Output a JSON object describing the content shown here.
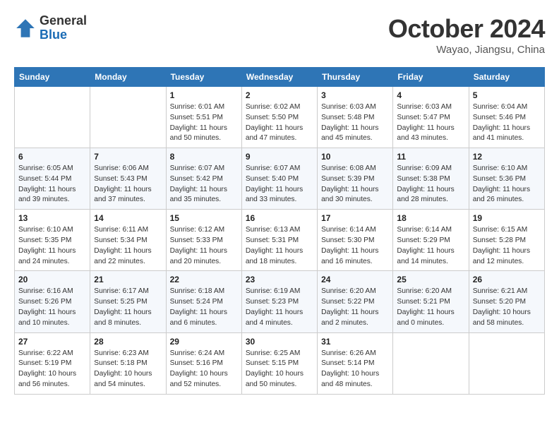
{
  "header": {
    "logo_general": "General",
    "logo_blue": "Blue",
    "month_title": "October 2024",
    "location": "Wayao, Jiangsu, China"
  },
  "days_of_week": [
    "Sunday",
    "Monday",
    "Tuesday",
    "Wednesday",
    "Thursday",
    "Friday",
    "Saturday"
  ],
  "weeks": [
    [
      {
        "day": "",
        "sunrise": "",
        "sunset": "",
        "daylight": ""
      },
      {
        "day": "",
        "sunrise": "",
        "sunset": "",
        "daylight": ""
      },
      {
        "day": "1",
        "sunrise": "Sunrise: 6:01 AM",
        "sunset": "Sunset: 5:51 PM",
        "daylight": "Daylight: 11 hours and 50 minutes."
      },
      {
        "day": "2",
        "sunrise": "Sunrise: 6:02 AM",
        "sunset": "Sunset: 5:50 PM",
        "daylight": "Daylight: 11 hours and 47 minutes."
      },
      {
        "day": "3",
        "sunrise": "Sunrise: 6:03 AM",
        "sunset": "Sunset: 5:48 PM",
        "daylight": "Daylight: 11 hours and 45 minutes."
      },
      {
        "day": "4",
        "sunrise": "Sunrise: 6:03 AM",
        "sunset": "Sunset: 5:47 PM",
        "daylight": "Daylight: 11 hours and 43 minutes."
      },
      {
        "day": "5",
        "sunrise": "Sunrise: 6:04 AM",
        "sunset": "Sunset: 5:46 PM",
        "daylight": "Daylight: 11 hours and 41 minutes."
      }
    ],
    [
      {
        "day": "6",
        "sunrise": "Sunrise: 6:05 AM",
        "sunset": "Sunset: 5:44 PM",
        "daylight": "Daylight: 11 hours and 39 minutes."
      },
      {
        "day": "7",
        "sunrise": "Sunrise: 6:06 AM",
        "sunset": "Sunset: 5:43 PM",
        "daylight": "Daylight: 11 hours and 37 minutes."
      },
      {
        "day": "8",
        "sunrise": "Sunrise: 6:07 AM",
        "sunset": "Sunset: 5:42 PM",
        "daylight": "Daylight: 11 hours and 35 minutes."
      },
      {
        "day": "9",
        "sunrise": "Sunrise: 6:07 AM",
        "sunset": "Sunset: 5:40 PM",
        "daylight": "Daylight: 11 hours and 33 minutes."
      },
      {
        "day": "10",
        "sunrise": "Sunrise: 6:08 AM",
        "sunset": "Sunset: 5:39 PM",
        "daylight": "Daylight: 11 hours and 30 minutes."
      },
      {
        "day": "11",
        "sunrise": "Sunrise: 6:09 AM",
        "sunset": "Sunset: 5:38 PM",
        "daylight": "Daylight: 11 hours and 28 minutes."
      },
      {
        "day": "12",
        "sunrise": "Sunrise: 6:10 AM",
        "sunset": "Sunset: 5:36 PM",
        "daylight": "Daylight: 11 hours and 26 minutes."
      }
    ],
    [
      {
        "day": "13",
        "sunrise": "Sunrise: 6:10 AM",
        "sunset": "Sunset: 5:35 PM",
        "daylight": "Daylight: 11 hours and 24 minutes."
      },
      {
        "day": "14",
        "sunrise": "Sunrise: 6:11 AM",
        "sunset": "Sunset: 5:34 PM",
        "daylight": "Daylight: 11 hours and 22 minutes."
      },
      {
        "day": "15",
        "sunrise": "Sunrise: 6:12 AM",
        "sunset": "Sunset: 5:33 PM",
        "daylight": "Daylight: 11 hours and 20 minutes."
      },
      {
        "day": "16",
        "sunrise": "Sunrise: 6:13 AM",
        "sunset": "Sunset: 5:31 PM",
        "daylight": "Daylight: 11 hours and 18 minutes."
      },
      {
        "day": "17",
        "sunrise": "Sunrise: 6:14 AM",
        "sunset": "Sunset: 5:30 PM",
        "daylight": "Daylight: 11 hours and 16 minutes."
      },
      {
        "day": "18",
        "sunrise": "Sunrise: 6:14 AM",
        "sunset": "Sunset: 5:29 PM",
        "daylight": "Daylight: 11 hours and 14 minutes."
      },
      {
        "day": "19",
        "sunrise": "Sunrise: 6:15 AM",
        "sunset": "Sunset: 5:28 PM",
        "daylight": "Daylight: 11 hours and 12 minutes."
      }
    ],
    [
      {
        "day": "20",
        "sunrise": "Sunrise: 6:16 AM",
        "sunset": "Sunset: 5:26 PM",
        "daylight": "Daylight: 11 hours and 10 minutes."
      },
      {
        "day": "21",
        "sunrise": "Sunrise: 6:17 AM",
        "sunset": "Sunset: 5:25 PM",
        "daylight": "Daylight: 11 hours and 8 minutes."
      },
      {
        "day": "22",
        "sunrise": "Sunrise: 6:18 AM",
        "sunset": "Sunset: 5:24 PM",
        "daylight": "Daylight: 11 hours and 6 minutes."
      },
      {
        "day": "23",
        "sunrise": "Sunrise: 6:19 AM",
        "sunset": "Sunset: 5:23 PM",
        "daylight": "Daylight: 11 hours and 4 minutes."
      },
      {
        "day": "24",
        "sunrise": "Sunrise: 6:20 AM",
        "sunset": "Sunset: 5:22 PM",
        "daylight": "Daylight: 11 hours and 2 minutes."
      },
      {
        "day": "25",
        "sunrise": "Sunrise: 6:20 AM",
        "sunset": "Sunset: 5:21 PM",
        "daylight": "Daylight: 11 hours and 0 minutes."
      },
      {
        "day": "26",
        "sunrise": "Sunrise: 6:21 AM",
        "sunset": "Sunset: 5:20 PM",
        "daylight": "Daylight: 10 hours and 58 minutes."
      }
    ],
    [
      {
        "day": "27",
        "sunrise": "Sunrise: 6:22 AM",
        "sunset": "Sunset: 5:19 PM",
        "daylight": "Daylight: 10 hours and 56 minutes."
      },
      {
        "day": "28",
        "sunrise": "Sunrise: 6:23 AM",
        "sunset": "Sunset: 5:18 PM",
        "daylight": "Daylight: 10 hours and 54 minutes."
      },
      {
        "day": "29",
        "sunrise": "Sunrise: 6:24 AM",
        "sunset": "Sunset: 5:16 PM",
        "daylight": "Daylight: 10 hours and 52 minutes."
      },
      {
        "day": "30",
        "sunrise": "Sunrise: 6:25 AM",
        "sunset": "Sunset: 5:15 PM",
        "daylight": "Daylight: 10 hours and 50 minutes."
      },
      {
        "day": "31",
        "sunrise": "Sunrise: 6:26 AM",
        "sunset": "Sunset: 5:14 PM",
        "daylight": "Daylight: 10 hours and 48 minutes."
      },
      {
        "day": "",
        "sunrise": "",
        "sunset": "",
        "daylight": ""
      },
      {
        "day": "",
        "sunrise": "",
        "sunset": "",
        "daylight": ""
      }
    ]
  ]
}
